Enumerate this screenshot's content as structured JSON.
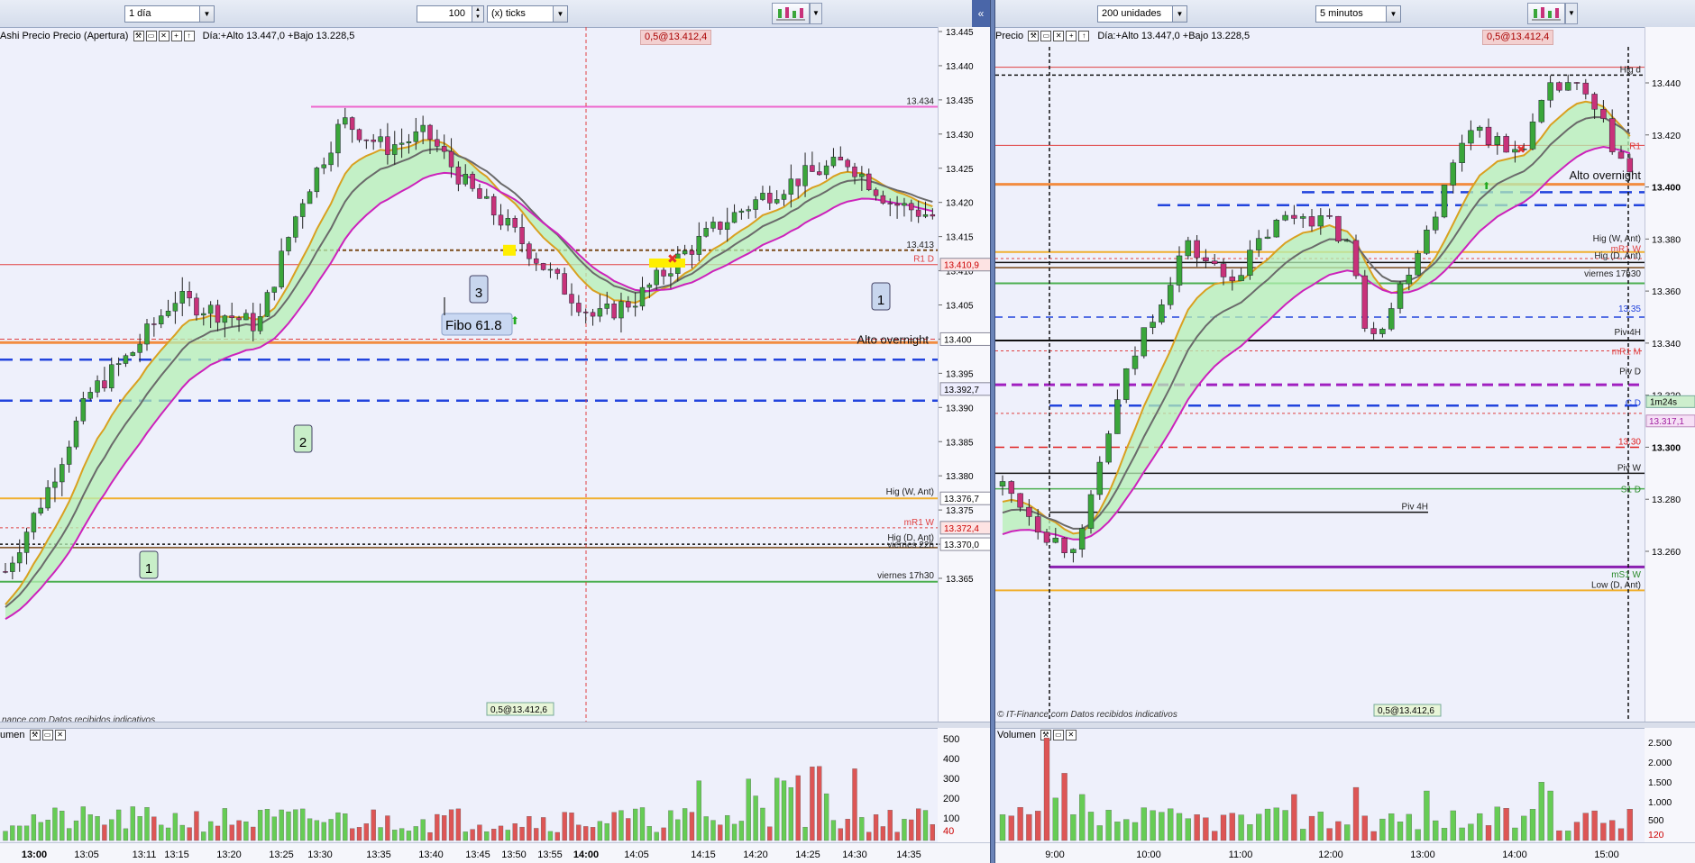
{
  "left": {
    "interval": "1 día",
    "ticks_value": "100",
    "ticks_unit": "(x) ticks",
    "header_label": "Ashi Precio Precio (Apertura)",
    "header_info": "Día:+Alto 13.447,0 +Bajo 13.228,5",
    "top_tag": "0,5@13.412,4",
    "price_ticks": [
      "13.445",
      "13.440",
      "13.435",
      "13.430",
      "13.425",
      "13.420",
      "13.415",
      "13.410",
      "13.405",
      "13.400",
      "13.395",
      "13.390",
      "13.385",
      "13.380",
      "13.375",
      "13.370",
      "13.365"
    ],
    "price_tags": {
      "t13434": "13.434",
      "t13413": "13.413",
      "t13410": "13.410,9",
      "r1d": "R1 D",
      "t13400": "13.400",
      "alto": "Alto overnight",
      "t13392": "13.392,7",
      "hig_w": "Hig (W, Ant)",
      "t13376": "13.376,7",
      "mr1w": "mR1 W",
      "t13372": "13.372,4",
      "hig_d": "Hig (D, Ant)",
      "t13370": "13.370,0",
      "viernes22": "viernes 22h",
      "viernes17": "viernes 17h30",
      "bottom_tag": "0,5@13.412,6",
      "footer": "nance.com  Datos recibidos indicativos"
    },
    "annotations": {
      "fibo": "Fibo 61.8",
      "m1": "1",
      "m2": "2",
      "m3": "3",
      "m1b": "1"
    },
    "volume_label": "umen",
    "volume_ticks": [
      "500",
      "400",
      "300",
      "200",
      "100",
      "40"
    ],
    "time_labels": [
      "13:00",
      "13:05",
      "13:11",
      "13:15",
      "13:20",
      "13:25",
      "13:30",
      "13:35",
      "13:40",
      "13:45",
      "13:50",
      "13:55",
      "14:00",
      "14:05",
      "14:15",
      "14:20",
      "14:25",
      "14:30",
      "14:35"
    ]
  },
  "right": {
    "size": "200 unidades",
    "interval": "5 minutos",
    "header_label": "Precio",
    "header_info": "Día:+Alto 13.447,0 +Bajo 13.228,5",
    "top_tag": "0,5@13.412,4",
    "price_ticks": [
      "13.440",
      "13.420",
      "13.400",
      "13.380",
      "13.360",
      "13.340",
      "13.320",
      "13.300",
      "13.280",
      "13.260"
    ],
    "price_tags": {
      "hig_d": "Hig d",
      "r1": "R1",
      "alto": "Alto overnight",
      "hig_w": "Hig (W, Ant)",
      "mr1w": "mR1 W",
      "hig_d_ant": "Hig (D, Ant)",
      "viernes": "viernes 17h30",
      "t1335": "13.35",
      "piv4h": "Piv 4H",
      "mr1m": "mR1 M",
      "pivd": "Piv D",
      "cd": "C D",
      "countdown": "1m24s",
      "t13317": "13.317,1",
      "t1330": "13.30",
      "pivw": "Piv W",
      "s1d": "S1 D",
      "piv4h_low": "Piv 4H",
      "ms1w": "mS1 W",
      "low_d": "Low (D, Ant)",
      "bottom_tag": "0,5@13.412,6",
      "footer": "© IT-Finance.com  Datos recibidos indicativos"
    },
    "volume_label": "Volumen",
    "volume_ticks": [
      "2.500",
      "2.000",
      "1.500",
      "1.000",
      "500",
      "120"
    ],
    "time_labels": [
      "9:00",
      "10:00",
      "11:00",
      "12:00",
      "13:00",
      "14:00",
      "15:00"
    ]
  },
  "colors": {
    "bull": "#3aa63a",
    "bear": "#c8327a",
    "ema_fill": "#b4f0b4",
    "ema_orange": "#d9a020",
    "ema_gray": "#6a6a6a",
    "ema_magenta": "#cc22bb",
    "vol_up": "#66cc55",
    "vol_down": "#dd5555"
  }
}
